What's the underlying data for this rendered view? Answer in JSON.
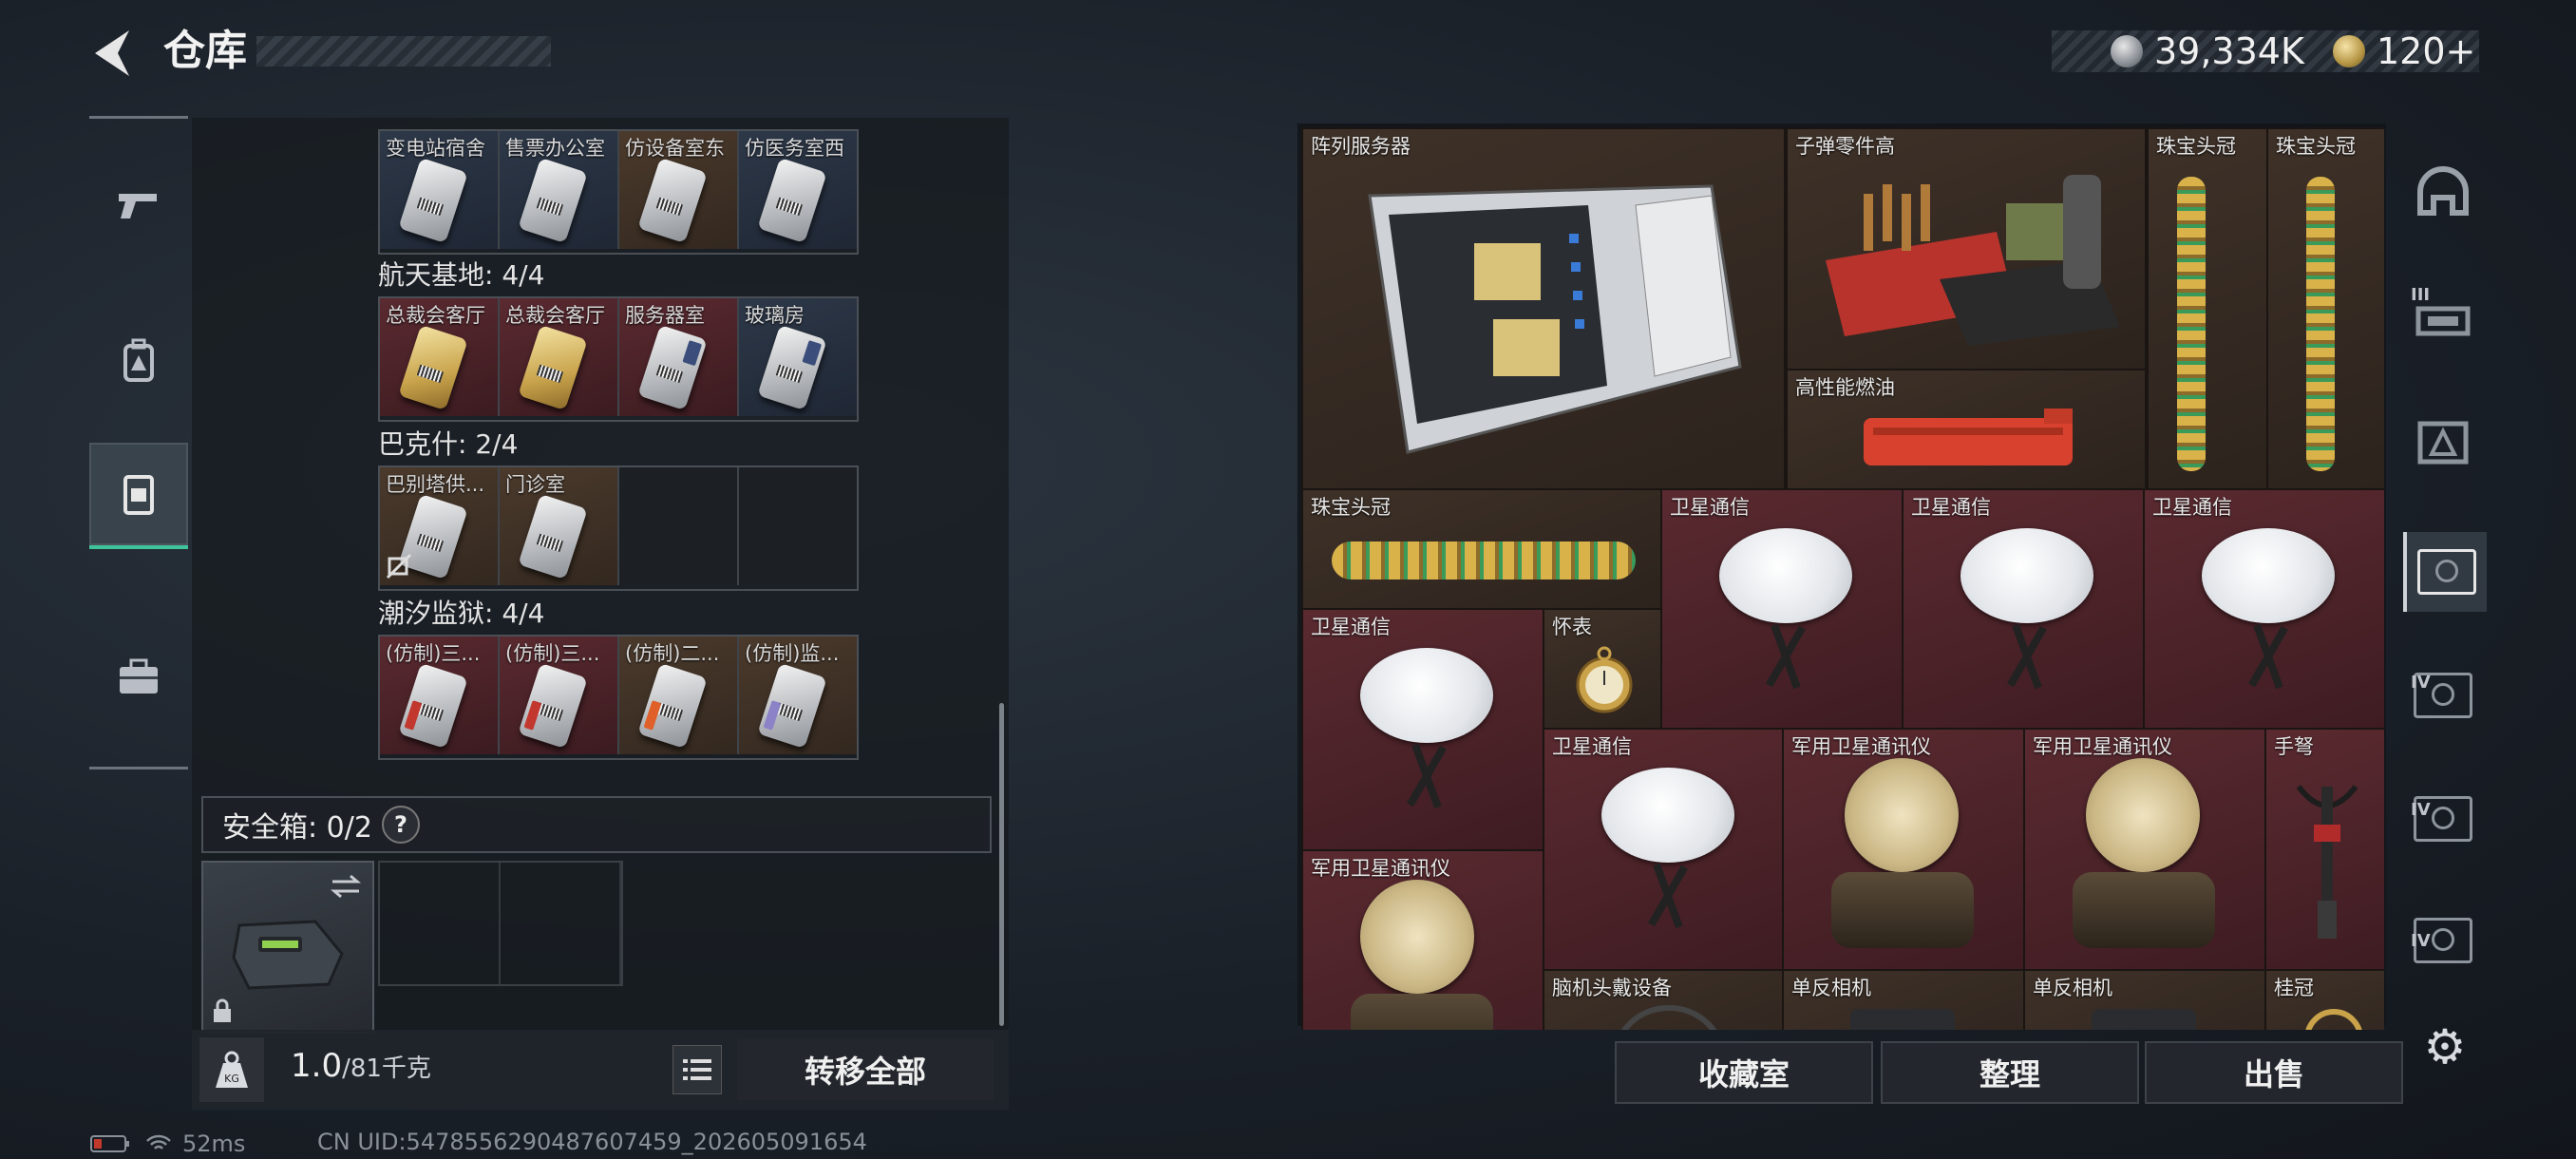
{
  "header": {
    "title": "仓库"
  },
  "currency": {
    "coins": "39,334K",
    "tokens": "120+"
  },
  "left_rail": {
    "tabs": [
      "gun-icon",
      "backpack-icon",
      "vest-icon",
      "case-icon"
    ]
  },
  "stash_sections": [
    {
      "title": "",
      "cells": [
        "变电站宿舍",
        "售票办公室",
        "仿设备室东",
        "仿医务室西"
      ]
    },
    {
      "title": "航天基地: 4/4",
      "cells": [
        "总裁会客厅",
        "总裁会客厅",
        "服务器室",
        "玻璃房"
      ]
    },
    {
      "title": "巴克什: 2/4",
      "cells": [
        "巴别塔供...",
        "门诊室",
        "",
        ""
      ]
    },
    {
      "title": "潮汐监狱: 4/4",
      "cells": [
        "(仿制)三...",
        "(仿制)三...",
        "(仿制)二...",
        "(仿制)监..."
      ]
    }
  ],
  "safe_box": {
    "title": "安全箱: 0/2",
    "help": "?"
  },
  "weight": {
    "current": "1.0",
    "max": "/81千克"
  },
  "buttons": {
    "transfer_all": "转移全部",
    "collection": "收藏室",
    "organize": "整理",
    "sell": "出售"
  },
  "status": {
    "ping": "52ms",
    "uid": "CN UID:5478556290487607459_202605091654"
  },
  "inventory": {
    "server": "阵列服务器",
    "bullet_parts": "子弹零件高",
    "crown1": "珠宝头冠",
    "crown2": "珠宝头冠",
    "fuel": "高性能燃油",
    "crown3": "珠宝头冠",
    "sat1": "卫星通信",
    "sat2": "卫星通信",
    "sat3": "卫星通信",
    "sat4": "卫星通信",
    "watch": "怀表",
    "sat5": "卫星通信",
    "mil1": "军用卫星通讯仪",
    "mil2": "军用卫星通讯仪",
    "crossbow": "手弩",
    "mil3": "军用卫星通讯仪",
    "bci": "脑机头戴设备",
    "cam1": "单反相机",
    "cam2": "单反相机",
    "crown4": "桂冠"
  },
  "right_rail": {
    "tags": [
      "III",
      "IV",
      "IV",
      "IV"
    ]
  },
  "colors": {
    "accent": "#3fc39a",
    "red_cell": "#5a2a30",
    "brown_cell": "#3e3128"
  }
}
